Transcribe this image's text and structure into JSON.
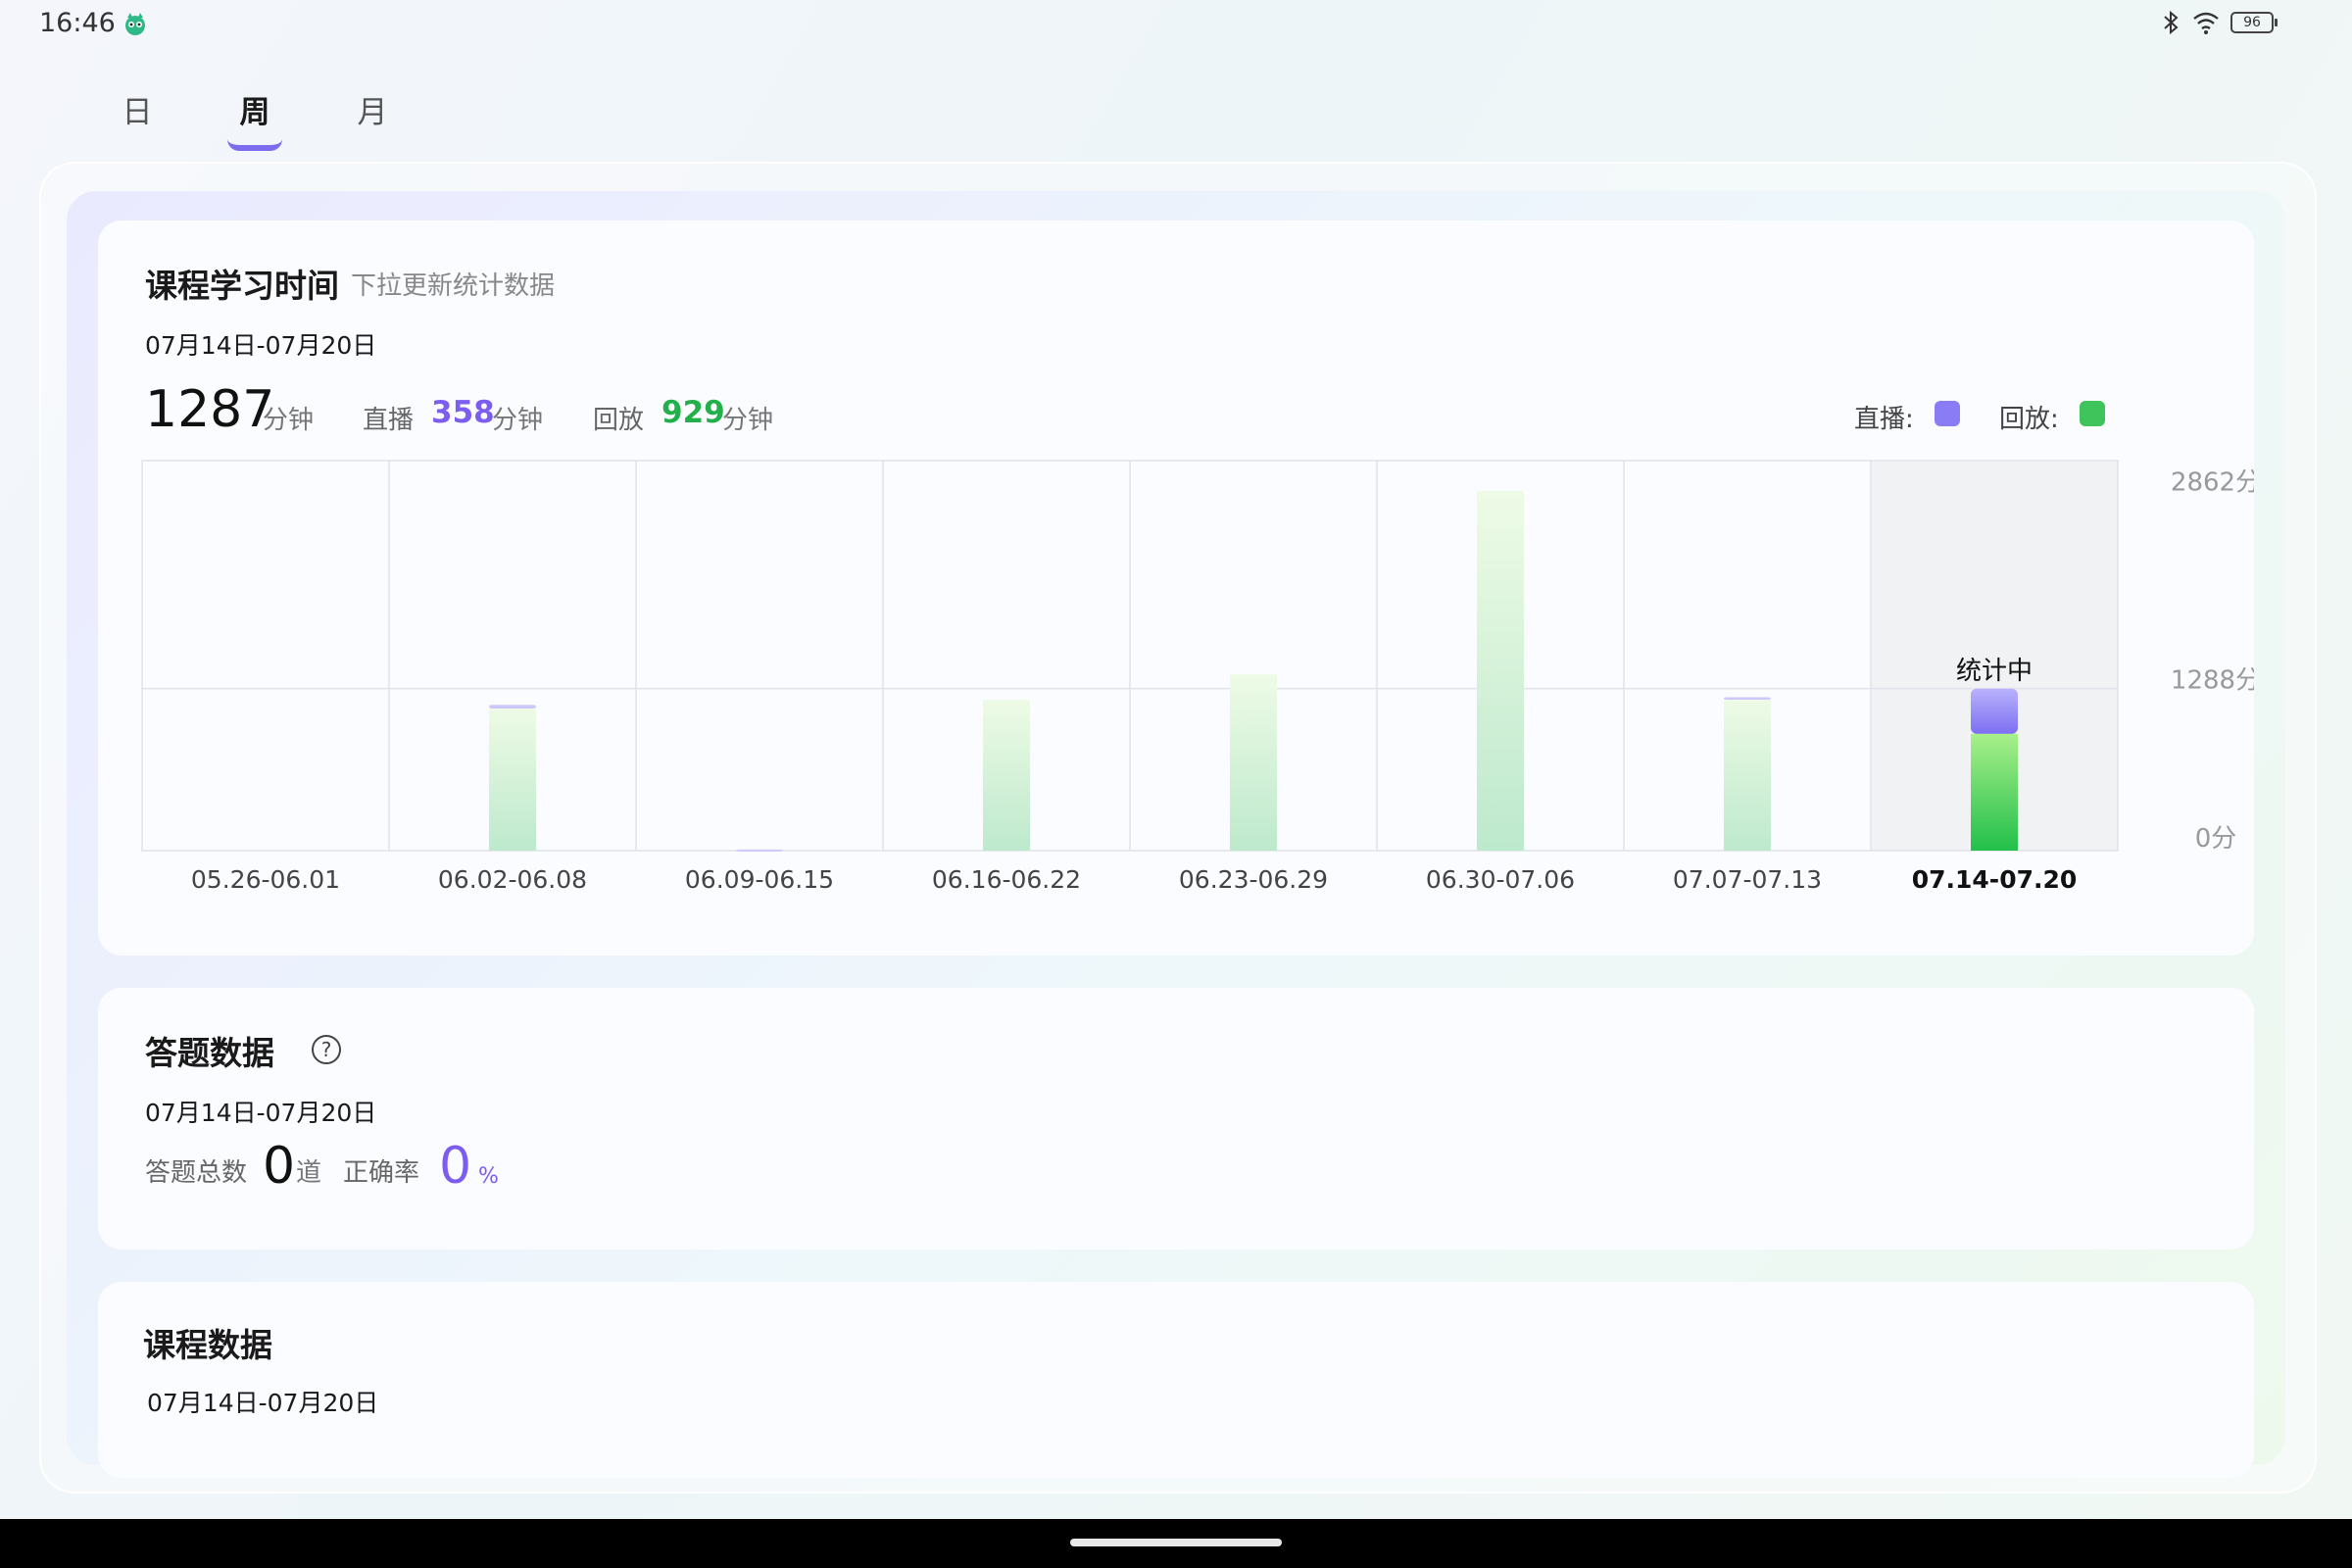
{
  "status": {
    "time": "16:46",
    "battery": "96"
  },
  "tabs": [
    {
      "label": "日"
    },
    {
      "label": "周"
    },
    {
      "label": "月"
    }
  ],
  "active_tab": "周",
  "study_time": {
    "title": "课程学习时间",
    "subtitle": "下拉更新统计数据",
    "range": "07月14日-07月20日",
    "total": "1287",
    "total_unit": "分钟",
    "live_label": "直播",
    "live_value": "358",
    "live_unit": "分钟",
    "replay_label": "回放",
    "replay_value": "929",
    "replay_unit": "分钟",
    "legend_live": "直播:",
    "legend_replay": "回放:",
    "in_progress_label": "统计中"
  },
  "colors": {
    "live": "#8a7cf5",
    "replay": "#3ec45a",
    "accent": "#7b5ef0"
  },
  "chart_data": {
    "type": "bar",
    "stacked": true,
    "categories": [
      "05.26-06.01",
      "06.02-06.08",
      "06.09-06.15",
      "06.16-06.22",
      "06.23-06.29",
      "06.30-07.06",
      "07.07-07.13",
      "07.14-07.20"
    ],
    "series": [
      {
        "name": "直播",
        "values": [
          0,
          30,
          10,
          0,
          0,
          0,
          20,
          358
        ]
      },
      {
        "name": "回放",
        "values": [
          0,
          1130,
          0,
          1200,
          1400,
          2860,
          1200,
          929
        ]
      }
    ],
    "ytick_labels": [
      "2862分",
      "1288分",
      "0分"
    ],
    "ylim": [
      0,
      3100
    ],
    "grid": true,
    "current_category": "07.14-07.20"
  },
  "quiz": {
    "title": "答题数据",
    "range": "07月14日-07月20日",
    "total_label": "答题总数",
    "total_value": "0",
    "total_unit": "道",
    "accuracy_label": "正确率",
    "accuracy_value": "0",
    "accuracy_unit": "%"
  },
  "course": {
    "title": "课程数据",
    "range": "07月14日-07月20日"
  }
}
